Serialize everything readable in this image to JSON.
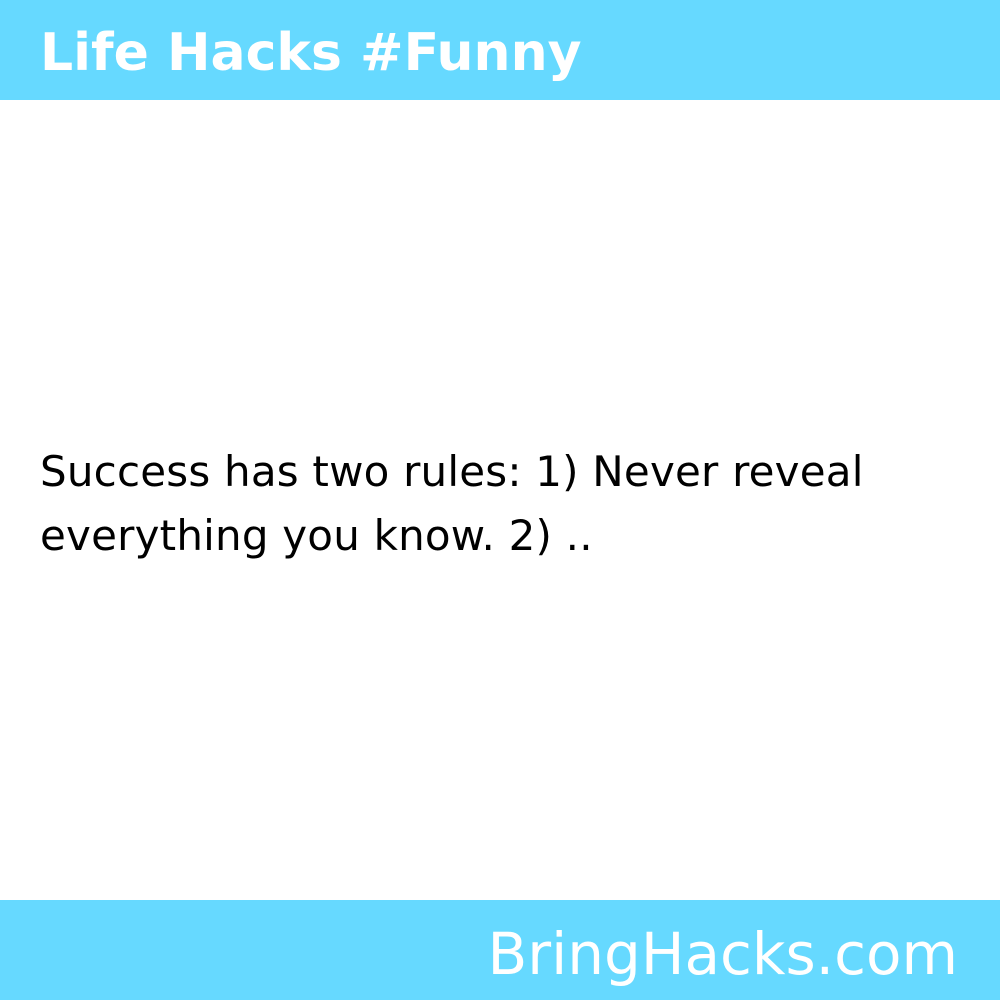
{
  "header": {
    "title": "Life Hacks #Funny"
  },
  "main": {
    "quote": "Success has two rules: 1) Never reveal everything you know. 2) .."
  },
  "footer": {
    "brand": "BringHacks.com"
  },
  "colors": {
    "accent": "#66d9ff",
    "background": "#ffffff",
    "text": "#000000",
    "bar_text": "#ffffff"
  }
}
